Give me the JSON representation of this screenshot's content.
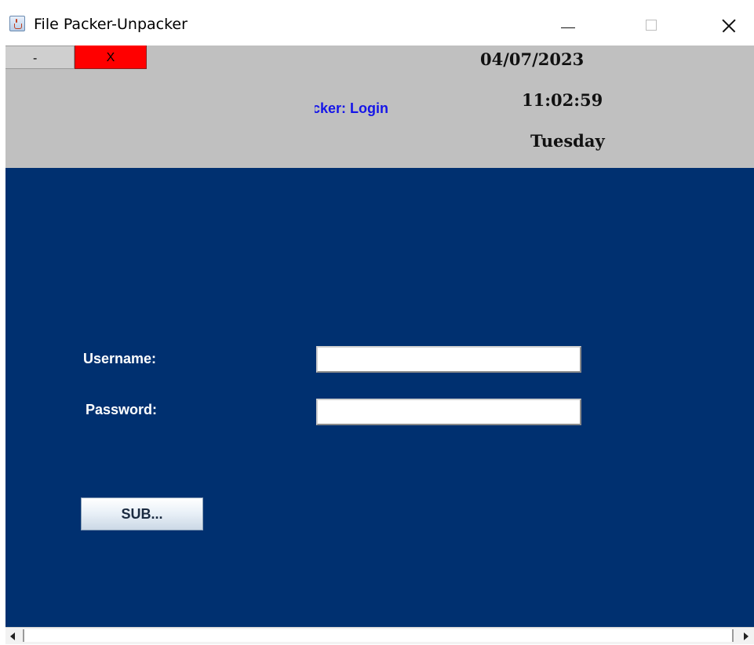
{
  "window": {
    "title": "File Packer-Unpacker",
    "icon": "java-cup-icon"
  },
  "header": {
    "minimize_label": "-",
    "close_label": "X",
    "title": "Inpacker: Login",
    "date": "04/07/2023",
    "time": "11:02:59",
    "day": "Tuesday"
  },
  "form": {
    "username_label": "Username:",
    "username_value": "",
    "password_label": "Password:",
    "password_value": "",
    "submit_label": "SUB..."
  },
  "colors": {
    "header_bg": "#c0c0c0",
    "main_bg": "#003070",
    "close_btn": "#ff0000",
    "title_text": "#1515e8"
  }
}
